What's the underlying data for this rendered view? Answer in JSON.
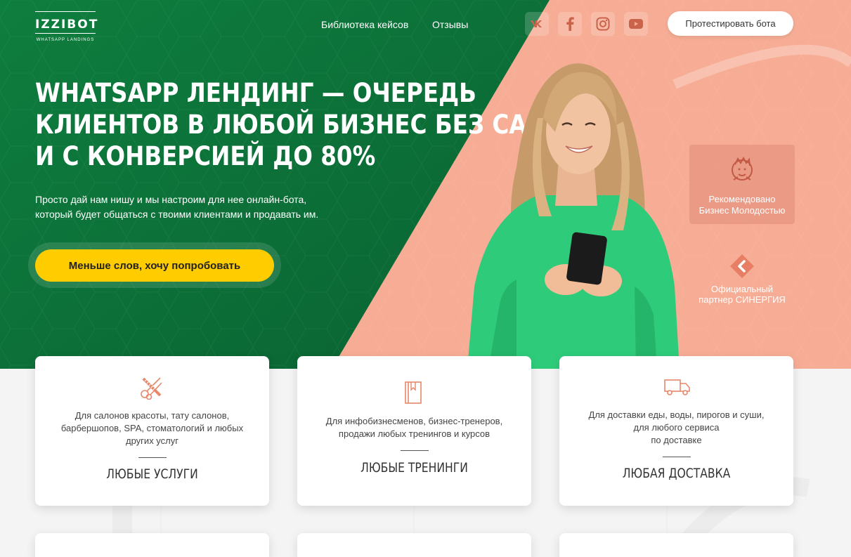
{
  "header": {
    "logo_main": "IZZIBOT",
    "logo_sub": "WHATSAPP LANDINGS",
    "nav": [
      "Библиотека кейсов",
      "Отзывы"
    ],
    "social_icons": [
      "vk-icon",
      "facebook-icon",
      "instagram-icon",
      "youtube-icon"
    ],
    "cta_label": "Протестировать бота"
  },
  "hero": {
    "headline_lines": [
      "WHATSAPP ЛЕНДИНГ — ОЧЕРЕДЬ",
      "КЛИЕНТОВ В ЛЮБОЙ БИЗНЕС БЕЗ САЙТА",
      "И С КОНВЕРСИЕЙ ДО 80%"
    ],
    "subtitle_lines": [
      "Просто дай нам нишу и мы настроим для нее онлайн-бота,",
      "который будет общаться с твоими клиентами и продавать им."
    ],
    "cta_label": "Меньше слов, хочу попробовать",
    "badge_recommended": [
      "Рекомендовано",
      "Бизнес Молодостью"
    ],
    "badge_partner": [
      "Официальный",
      "партнер СИНЕРГИЯ"
    ]
  },
  "cards": [
    {
      "icon": "scissors-comb-icon",
      "desc_lines": [
        "Для салонов красоты, тату салонов,",
        "барбершопов, SPA, стоматологий и любых",
        "других услуг"
      ],
      "title": "ЛЮБЫЕ УСЛУГИ"
    },
    {
      "icon": "book-icon",
      "desc_lines": [
        "Для инфобизнесменов, бизнес-тренеров,",
        "продажи любых тренингов и курсов"
      ],
      "title": "ЛЮБЫЕ ТРЕНИНГИ"
    },
    {
      "icon": "delivery-truck-icon",
      "desc_lines": [
        "Для доставки еды, воды, пирогов и суши,",
        "для любого сервиса",
        "по доставке"
      ],
      "title": "ЛЮБАЯ ДОСТАВКА"
    }
  ],
  "colors": {
    "green": "#0d7a3c",
    "salmon": "#f8ae96",
    "yellow": "#ffcc00",
    "accent_icon": "#e8876a"
  }
}
